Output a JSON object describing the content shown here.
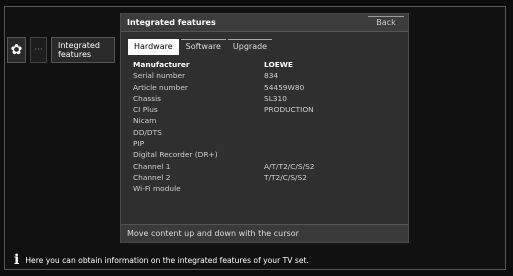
{
  "left_menu": {
    "gear_icon": "gear-icon",
    "dots_label": "···",
    "integrated_features_label": "Integrated\nfeatures"
  },
  "panel": {
    "title": "Integrated features",
    "back_label": "Back",
    "tabs": [
      {
        "label": "Hardware",
        "active": true
      },
      {
        "label": "Software",
        "active": false
      },
      {
        "label": "Upgrade",
        "active": false
      }
    ],
    "rows": [
      {
        "label": "Manufacturer",
        "value": "LOEWE"
      },
      {
        "label": "Serial number",
        "value": "834"
      },
      {
        "label": "Article number",
        "value": "54459W80"
      },
      {
        "label": "Chassis",
        "value": "SL310"
      },
      {
        "label": "CI Plus",
        "value": "PRODUCTION"
      },
      {
        "label": "Nicam",
        "value": ""
      },
      {
        "label": "DD/DTS",
        "value": ""
      },
      {
        "label": "PIP",
        "value": ""
      },
      {
        "label": "Digital Recorder (DR+)",
        "value": ""
      },
      {
        "label": "Channel 1",
        "value": "A/T/T2/C/S/S2"
      },
      {
        "label": "Channel 2",
        "value": "T/T2/C/S/S2"
      },
      {
        "label": "Wi-Fi module",
        "value": ""
      }
    ],
    "footer": "Move content up and down with the cursor"
  },
  "info": {
    "icon": "info-icon",
    "text": "Here you can obtain information on the integrated features of your TV set."
  }
}
